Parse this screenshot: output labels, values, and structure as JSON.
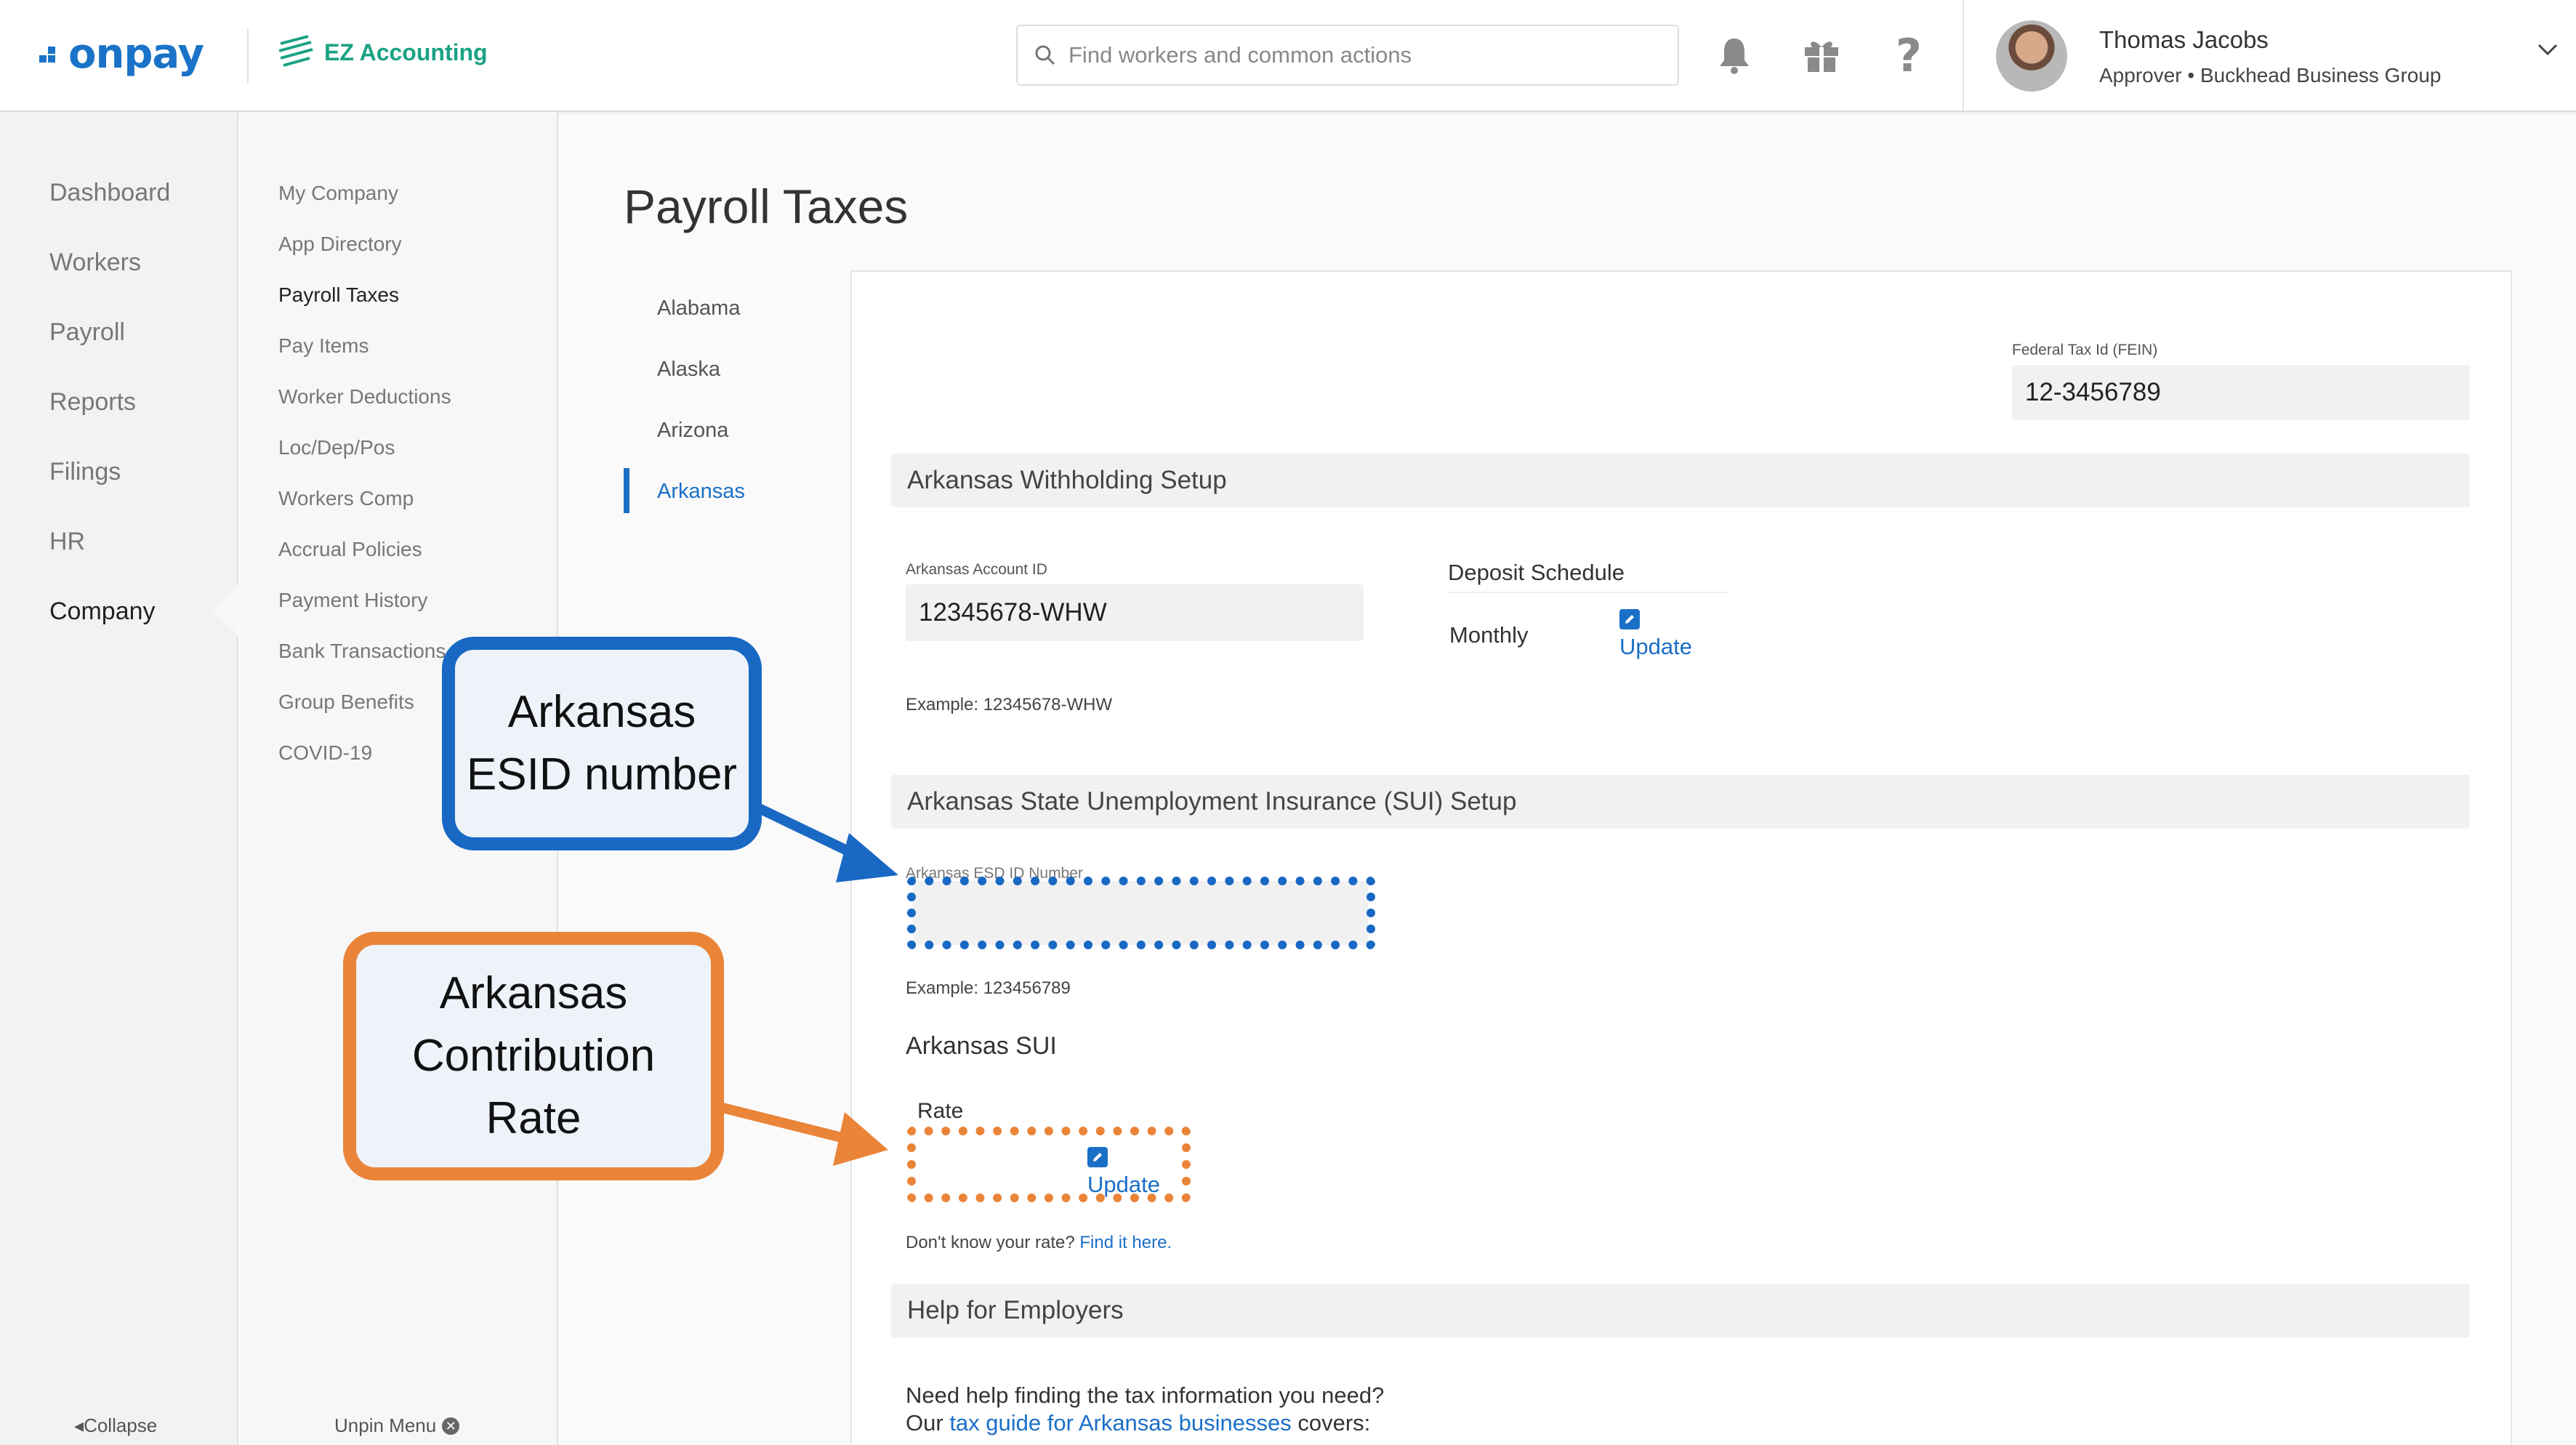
{
  "header": {
    "brand": "onpay",
    "partner_brand": "EZ Accounting",
    "search_placeholder": "Find workers and common actions",
    "icons": [
      "bell-icon",
      "gift-icon",
      "help-icon"
    ],
    "user": {
      "name": "Thomas Jacobs",
      "role": "Approver • Buckhead Business Group"
    }
  },
  "left_nav": {
    "items": [
      "Dashboard",
      "Workers",
      "Payroll",
      "Reports",
      "Filings",
      "HR",
      "Company"
    ],
    "active": "Company",
    "collapse_label": "Collapse"
  },
  "sub_nav": {
    "items": [
      "My Company",
      "App Directory",
      "Payroll Taxes",
      "Pay Items",
      "Worker Deductions",
      "Loc/Dep/Pos",
      "Workers Comp",
      "Accrual Policies",
      "Payment History",
      "Bank Transactions",
      "Group Benefits",
      "COVID-19"
    ],
    "active": "Payroll Taxes",
    "unpin_label": "Unpin Menu"
  },
  "main": {
    "title": "Payroll Taxes",
    "states": [
      "Alabama",
      "Alaska",
      "Arizona",
      "Arkansas"
    ],
    "active_state": "Arkansas",
    "fein_label": "Federal Tax Id (FEIN)",
    "fein_value": "12-3456789",
    "withholding": {
      "section_title": "Arkansas Withholding Setup",
      "account_label": "Arkansas Account ID",
      "account_value": "12345678-WHW",
      "account_example": "Example: 12345678-WHW",
      "deposit_label": "Deposit Schedule",
      "deposit_value": "Monthly",
      "update_label": "Update"
    },
    "sui": {
      "section_title": "Arkansas State Unemployment Insurance (SUI) Setup",
      "esd_label": "Arkansas ESD ID Number",
      "esd_value": "",
      "esd_example": "Example: 123456789",
      "sui_heading": "Arkansas SUI",
      "rate_label": "Rate",
      "rate_value": "",
      "update_label": "Update",
      "rate_help_prefix": "Don't know your rate?",
      "rate_help_link": "Find it here."
    },
    "help": {
      "section_title": "Help for Employers",
      "line1": "Need help finding the tax information you need?",
      "line2_prefix": "Our",
      "line2_link": "tax guide for Arkansas businesses",
      "line2_suffix": "covers:"
    }
  },
  "annotations": {
    "esid_callout": [
      "Arkansas",
      "ESID number"
    ],
    "rate_callout": [
      "Arkansas",
      "Contribution",
      "Rate"
    ],
    "colors": {
      "blue": "#1868c4",
      "orange": "#ea8438"
    }
  }
}
